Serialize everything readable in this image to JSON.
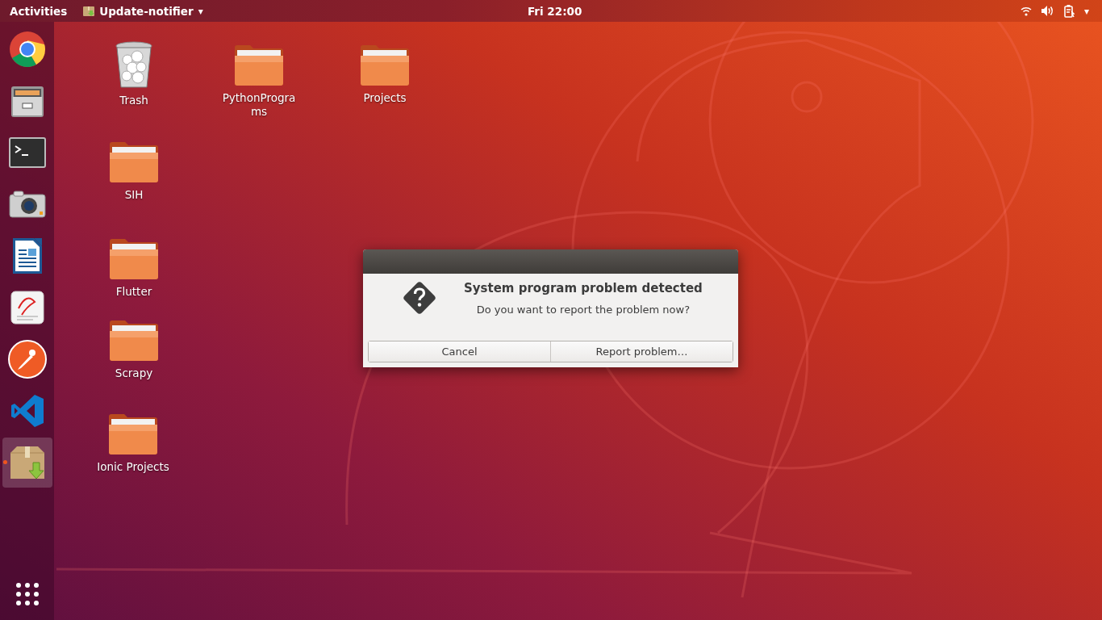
{
  "top_bar": {
    "activities": "Activities",
    "app_menu": {
      "label": "Update-notifier",
      "caret": "▾"
    },
    "clock": "Fri 22:00",
    "tray_caret": "▾"
  },
  "dock": {
    "items": [
      {
        "kind": "browser",
        "running": false,
        "selected": false
      },
      {
        "kind": "files",
        "running": false,
        "selected": false
      },
      {
        "kind": "terminal",
        "running": false,
        "selected": false
      },
      {
        "kind": "camera",
        "running": false,
        "selected": false
      },
      {
        "kind": "writer",
        "running": false,
        "selected": false
      },
      {
        "kind": "viewer",
        "running": false,
        "selected": false
      },
      {
        "kind": "postman",
        "running": false,
        "selected": false
      },
      {
        "kind": "code",
        "running": false,
        "selected": false
      },
      {
        "kind": "package",
        "running": true,
        "selected": true
      }
    ]
  },
  "desktop": {
    "icons": [
      {
        "kind": "trash",
        "label": "Trash"
      },
      {
        "kind": "folder",
        "label": "PythonPrograms"
      },
      {
        "kind": "folder",
        "label": "Projects"
      },
      {
        "kind": "folder",
        "label": "SIH"
      },
      {
        "kind": "folder",
        "label": "Flutter"
      },
      {
        "kind": "folder",
        "label": "Scrapy"
      },
      {
        "kind": "folder",
        "label": "Ionic Projects"
      }
    ]
  },
  "dialog": {
    "title": "System program problem detected",
    "message": "Do you want to report the problem now?",
    "buttons": [
      "Cancel",
      "Report problem…"
    ]
  }
}
